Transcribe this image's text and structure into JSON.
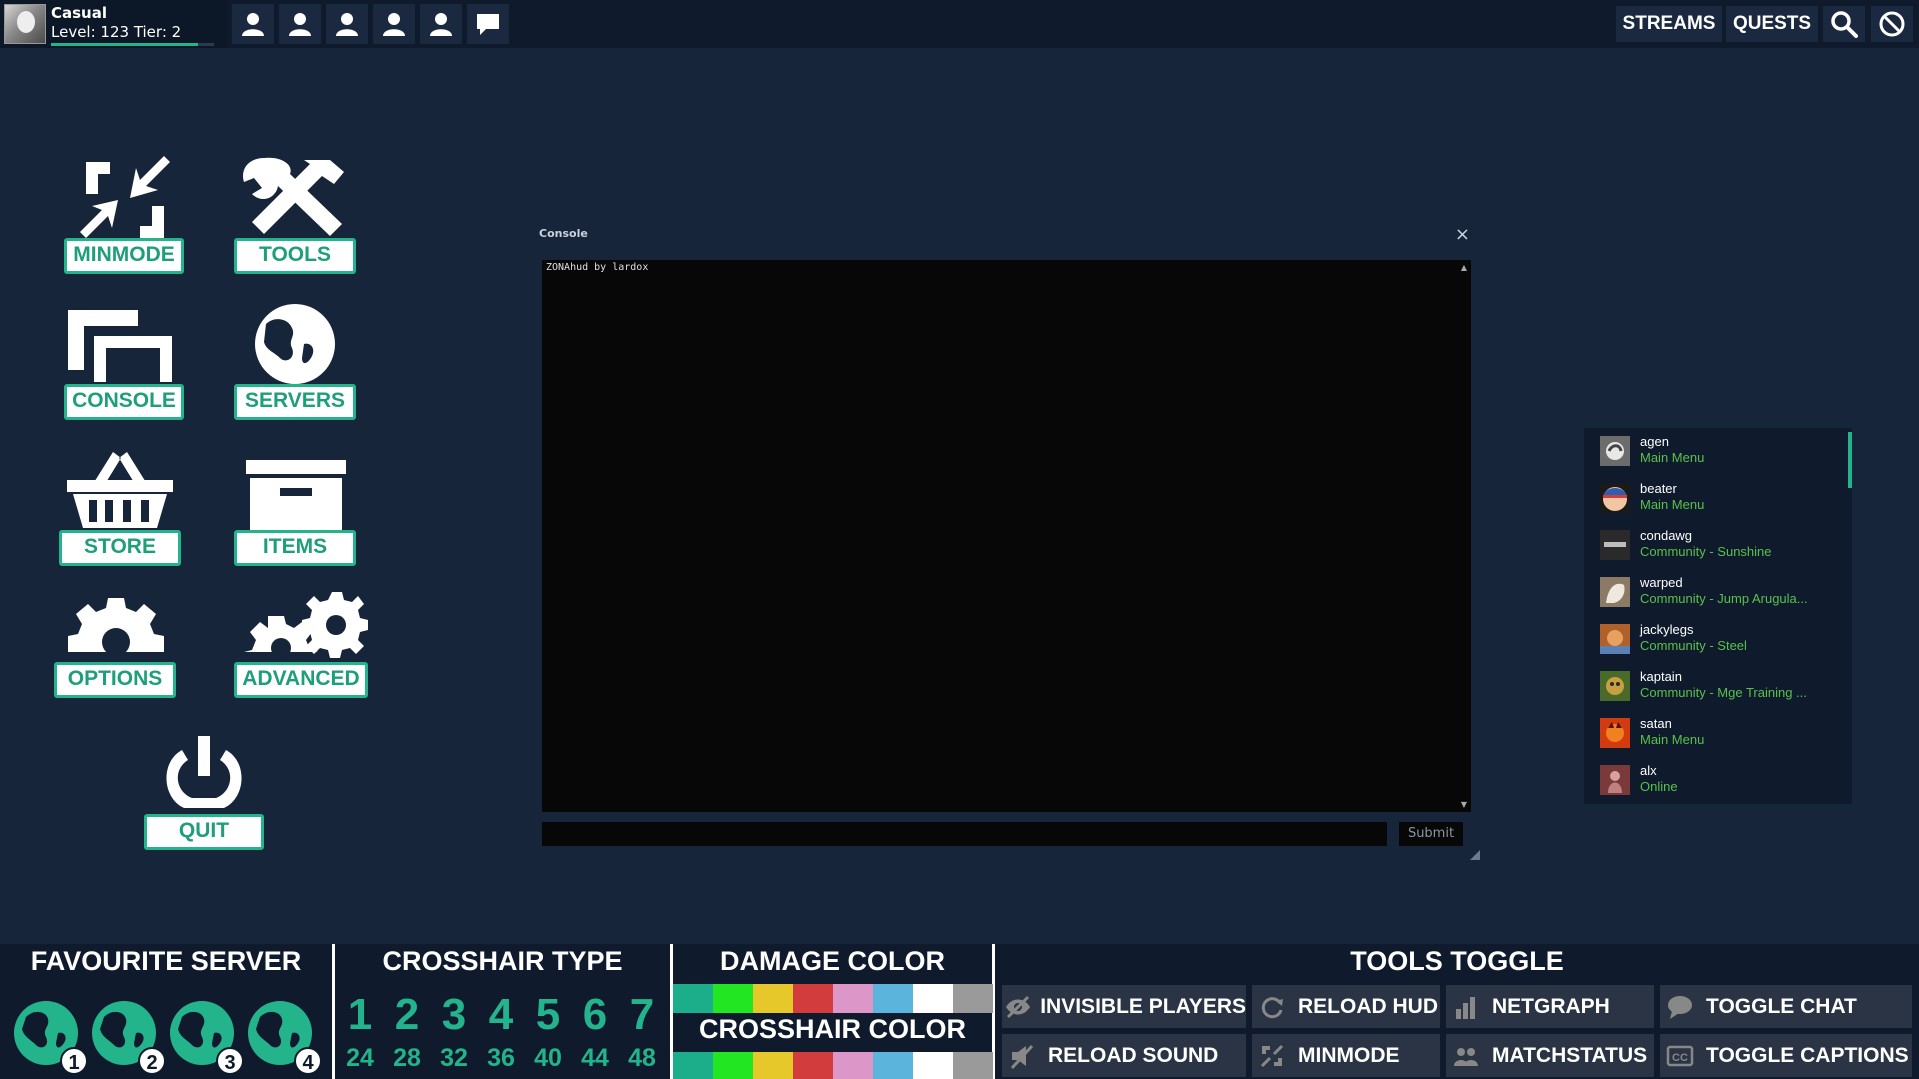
{
  "profile": {
    "name": "Casual",
    "level_text": "Level: 123 Tier: 2",
    "level_progress": 0.9
  },
  "top_nav": {
    "streams": "STREAMS",
    "quests": "QUESTS"
  },
  "menu": {
    "minmode": "MINMODE",
    "tools": "TOOLS",
    "console": "CONSOLE",
    "servers": "SERVERS",
    "store": "STORE",
    "items": "ITEMS",
    "options": "OPTIONS",
    "advanced": "ADVANCED",
    "quit": "QUIT"
  },
  "console": {
    "title": "Console",
    "close": "×",
    "output": "ZONAhud by lardox",
    "input_value": "",
    "submit": "Submit"
  },
  "friends": [
    {
      "name": "agen",
      "status": "Main Menu"
    },
    {
      "name": "beater",
      "status": "Main Menu"
    },
    {
      "name": "condawg",
      "status": "Community - Sunshine"
    },
    {
      "name": "warped",
      "status": "Community - Jump Arugula..."
    },
    {
      "name": "jackylegs",
      "status": "Community - Steel"
    },
    {
      "name": "kaptain",
      "status": "Community - Mge Training ..."
    },
    {
      "name": "satan",
      "status": "Main Menu"
    },
    {
      "name": "alx",
      "status": "Online"
    }
  ],
  "bottom": {
    "favourite_server": {
      "title": "FAVOURITE SERVER",
      "servers": [
        "1",
        "2",
        "3",
        "4"
      ]
    },
    "crosshair_type": {
      "title": "CROSSHAIR TYPE",
      "types": [
        "1",
        "2",
        "3",
        "4",
        "5",
        "6",
        "7"
      ],
      "sizes": [
        "24",
        "28",
        "32",
        "36",
        "40",
        "44",
        "48"
      ]
    },
    "damage_color": {
      "title": "DAMAGE COLOR"
    },
    "crosshair_color": {
      "title": "CROSSHAIR COLOR"
    },
    "colors": [
      "#1cae8a",
      "#22e622",
      "#e6c82a",
      "#d23c3c",
      "#dc96c8",
      "#5ab4dc",
      "#ffffff",
      "#9a9a9a"
    ],
    "tools_toggle": {
      "title": "TOOLS TOGGLE",
      "invisible_players": "INVISIBLE PLAYERS",
      "reload_hud": "RELOAD HUD",
      "netgraph": "NETGRAPH",
      "toggle_chat": "TOGGLE CHAT",
      "reload_sound": "RELOAD SOUND",
      "minmode": "MINMODE",
      "matchstatus": "MATCHSTATUS",
      "toggle_captions": "TOGGLE CAPTIONS"
    }
  }
}
